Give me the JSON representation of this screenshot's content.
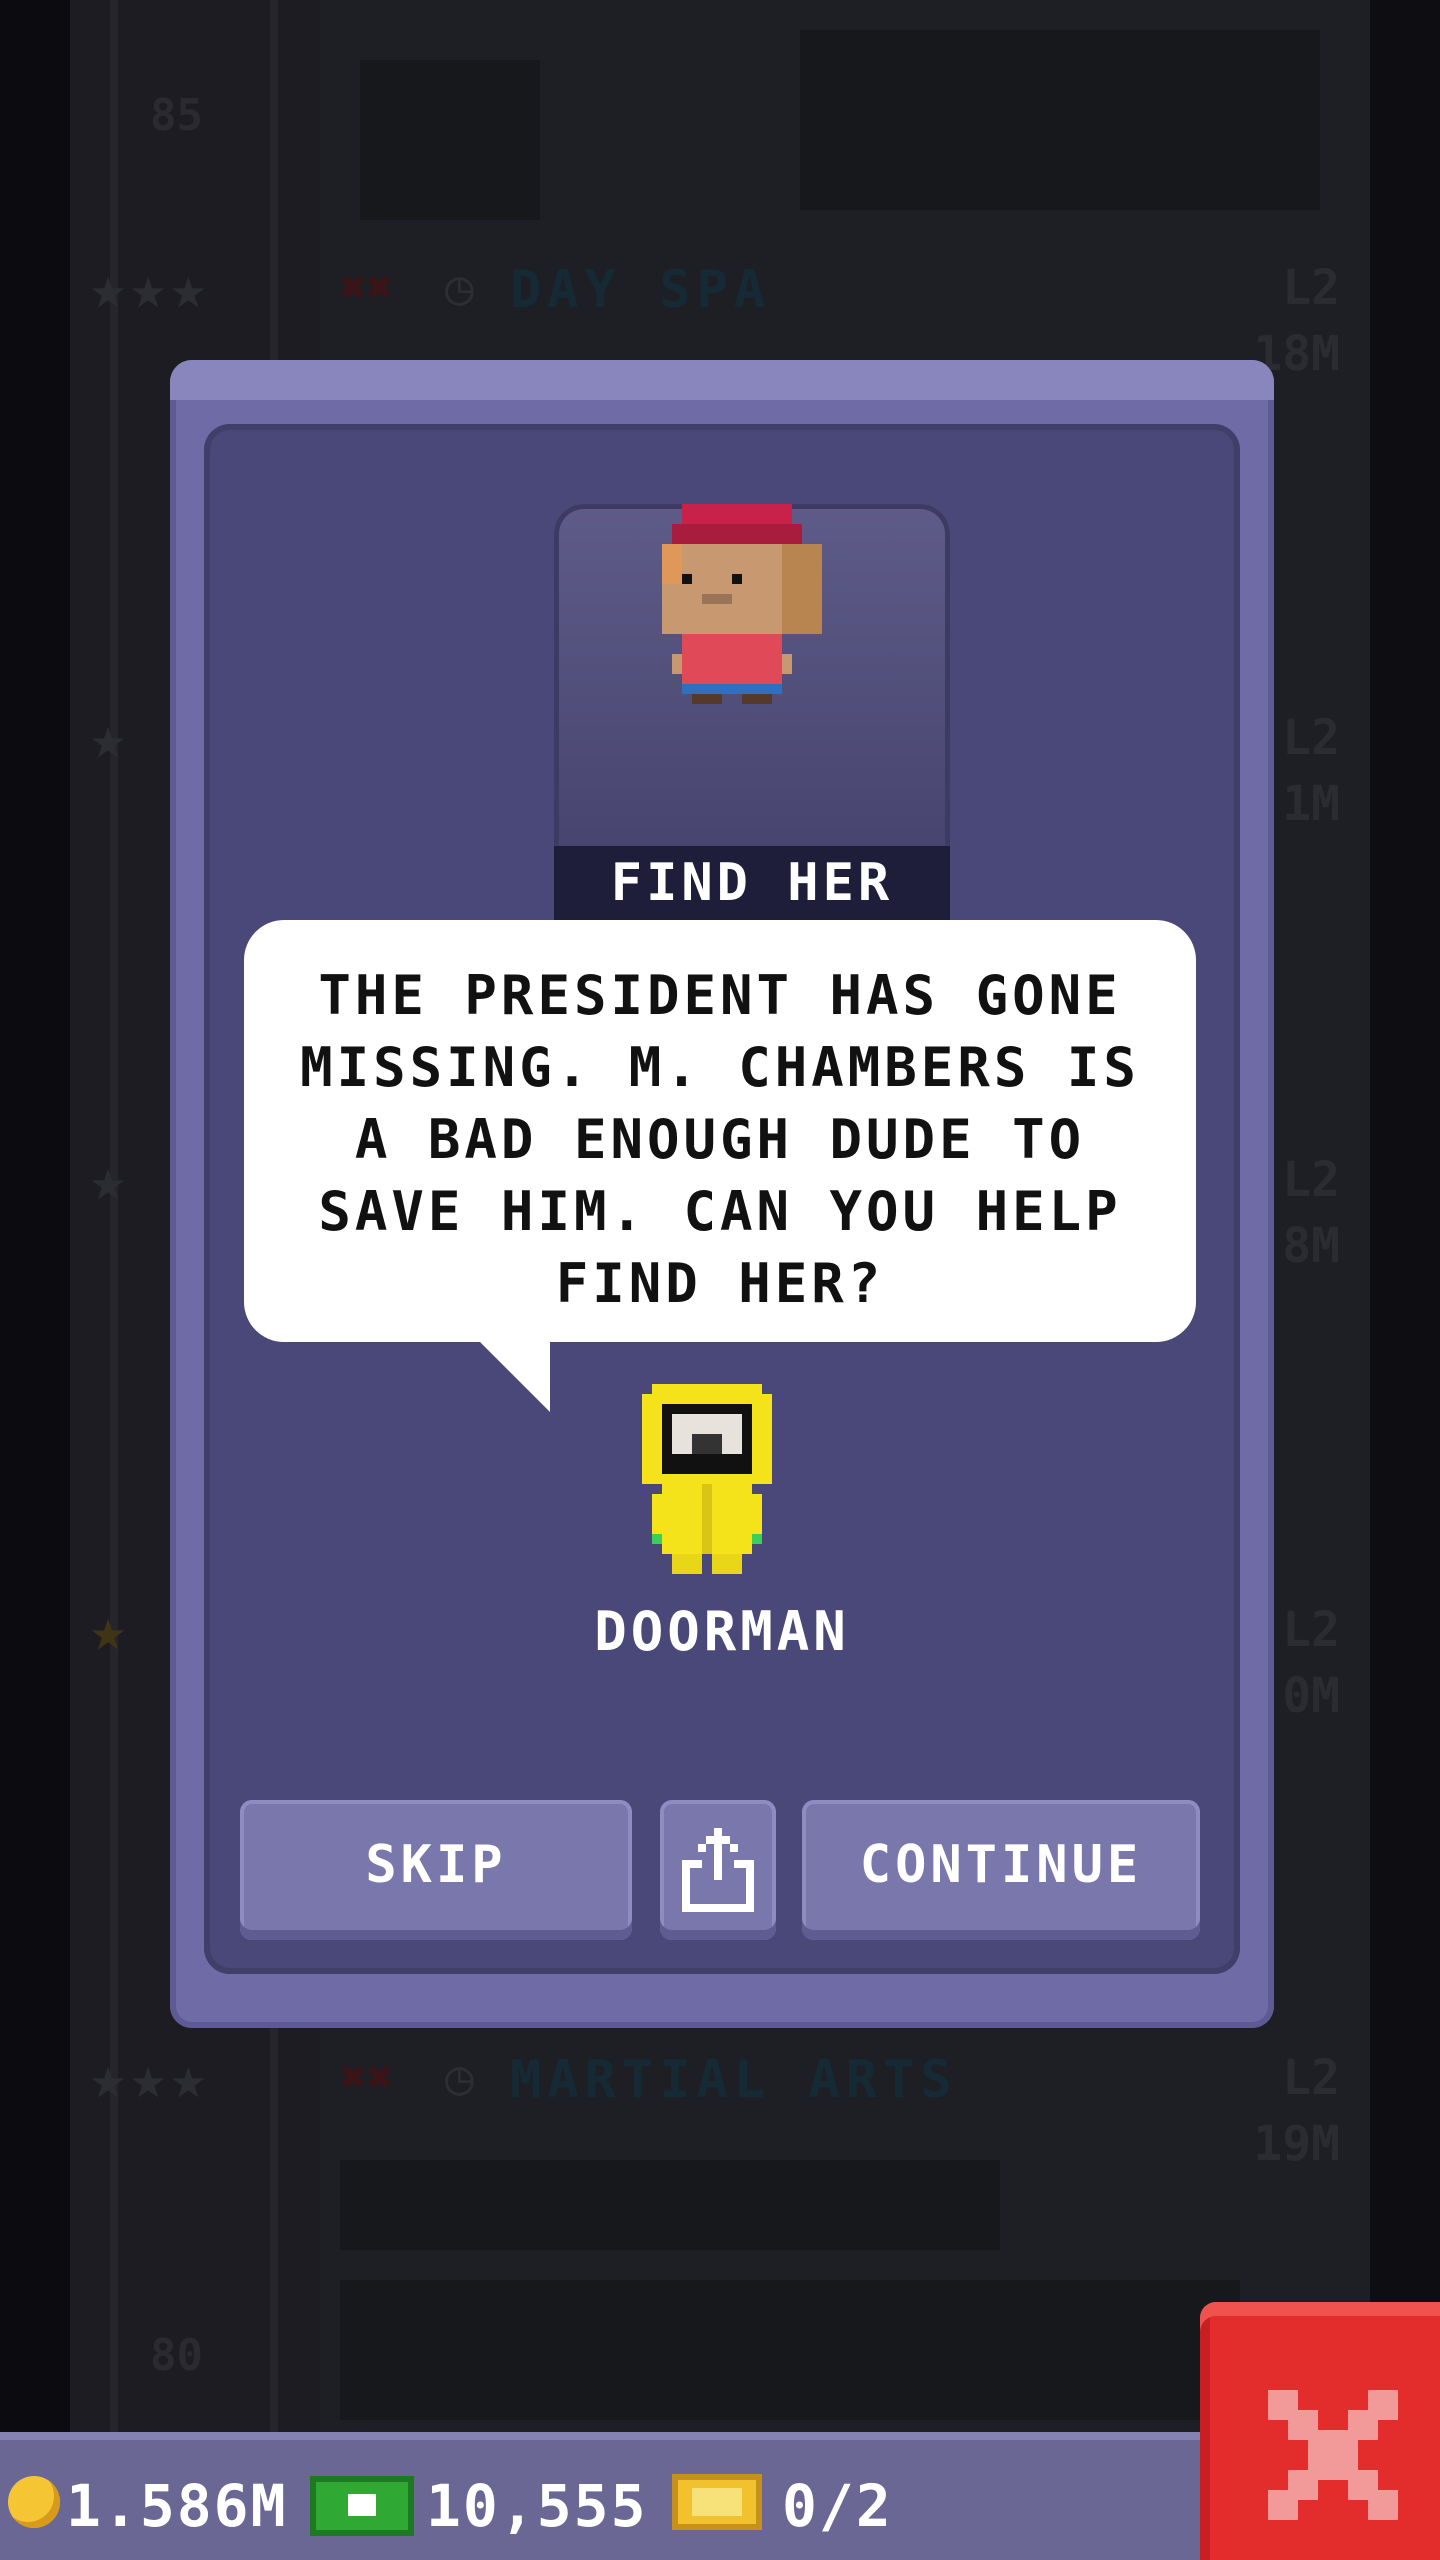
{
  "background": {
    "floors": [
      {
        "number": "85"
      },
      {
        "name": "DAY SPA",
        "level": "L2",
        "distance": "18M",
        "stars": 3
      },
      {
        "level": "L2",
        "distance": "1M",
        "stars": 1
      },
      {
        "level": "L2",
        "distance": "8M",
        "stars": 1
      },
      {
        "level": "L2",
        "distance": "0M",
        "stars": 1
      },
      {
        "name": "MARTIAL ARTS",
        "level": "L2",
        "distance": "19M",
        "stars": 3
      },
      {
        "number": "80"
      }
    ]
  },
  "quest": {
    "title": "FIND HER",
    "message": "THE PRESIDENT HAS GONE MISSING. M. CHAMBERS IS A BAD ENOUGH DUDE TO SAVE HIM. CAN YOU HELP FIND HER?",
    "speaker": "DOORMAN",
    "buttons": {
      "skip": "SKIP",
      "share_icon": "share-icon",
      "continue": "CONTINUE"
    }
  },
  "status_bar": {
    "coins": "1.586M",
    "bux": "10,555",
    "tickets": "0/2"
  },
  "colors": {
    "modal_border": "#6f6ba6",
    "modal_inner": "#4a4878",
    "close_button": "#e32d2d",
    "coin": "#f6c533",
    "bux": "#2fa834",
    "ticket": "#f2c12e"
  }
}
